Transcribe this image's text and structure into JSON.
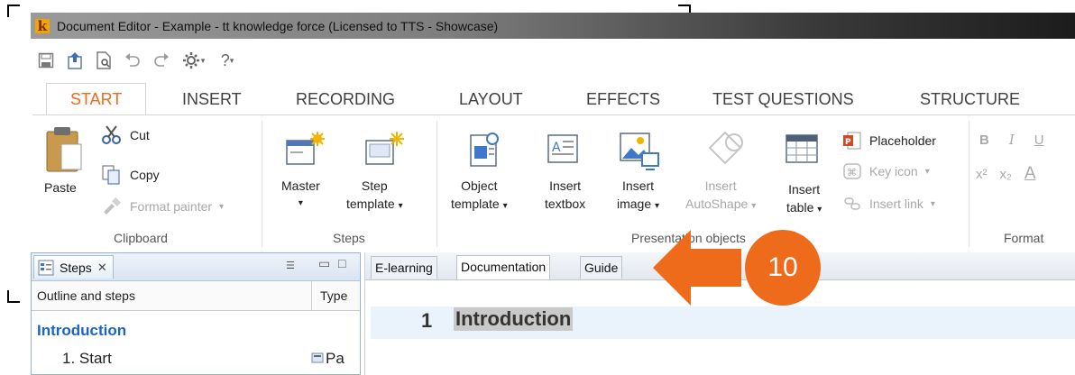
{
  "window": {
    "title": "Document Editor - Example - tt knowledge force (Licensed to TTS - Showcase)",
    "logo_letter": "k"
  },
  "quick_access": {
    "icons": [
      "save-icon",
      "upload-icon",
      "document-preview-icon",
      "undo-icon",
      "redo-icon",
      "settings-icon",
      "help-icon"
    ],
    "help_label": "?"
  },
  "ribbon_tabs": [
    "START",
    "INSERT",
    "RECORDING",
    "LAYOUT",
    "EFFECTS",
    "TEST QUESTIONS",
    "STRUCTURE"
  ],
  "ribbon": {
    "clipboard": {
      "label": "Clipboard",
      "paste": "Paste",
      "cut": "Cut",
      "copy": "Copy",
      "format_painter": "Format painter"
    },
    "steps": {
      "label": "Steps",
      "master": "Master",
      "step_template_1": "Step",
      "step_template_2": "template"
    },
    "presentation": {
      "label": "Presentation objects",
      "object_template_1": "Object",
      "object_template_2": "template",
      "insert_textbox_1": "Insert",
      "insert_textbox_2": "textbox",
      "insert_image_1": "Insert",
      "insert_image_2": "image",
      "insert_autoshape_1": "Insert",
      "insert_autoshape_2": "AutoShape",
      "insert_table_1": "Insert",
      "insert_table_2": "table",
      "placeholder": "Placeholder",
      "key_icon": "Key icon",
      "insert_link": "Insert link"
    },
    "format": {
      "label": "Format",
      "bold": "B",
      "italic": "I",
      "underline": "U",
      "superscript": "x²",
      "subscript": "x₂",
      "font_color": "A"
    }
  },
  "steps_panel": {
    "tab_label": "Steps",
    "columns": [
      "Outline and steps",
      "Type"
    ],
    "rows": [
      {
        "label": "Introduction",
        "type": "",
        "kind": "chapter"
      },
      {
        "label": "1. Start",
        "type": "Pa",
        "kind": "step"
      }
    ]
  },
  "document": {
    "tabs": [
      "E-learning",
      "Documentation",
      "Guide"
    ],
    "active_tab": "Documentation",
    "heading_number": "1",
    "heading_text": "Introduction"
  },
  "callout": {
    "number": "10",
    "color": "#ee6b1b"
  },
  "colors": {
    "accent": "#ef6a1a",
    "chapter_blue": "#1a64c8"
  }
}
